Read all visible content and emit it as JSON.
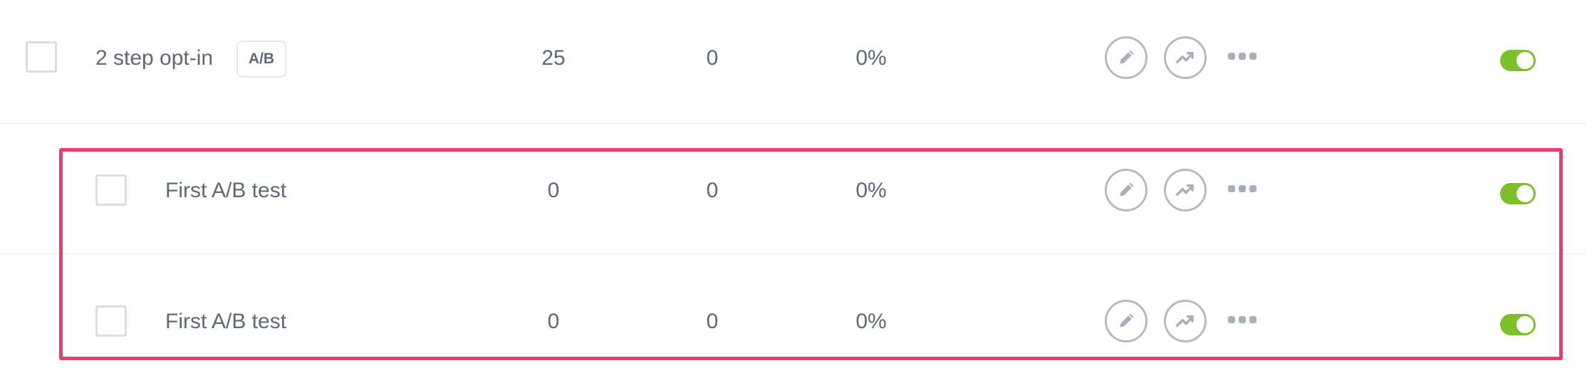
{
  "rows": [
    {
      "name": "2 step opt-in",
      "badge": "A/B",
      "col1": "25",
      "col2": "0",
      "col3": "0%",
      "icons": [
        "pencil-icon",
        "trend-icon",
        "more-icon"
      ],
      "enabled": true
    },
    {
      "name": "First A/B test",
      "col1": "0",
      "col2": "0",
      "col3": "0%",
      "icons": [
        "pencil-icon",
        "trend-icon",
        "more-icon"
      ],
      "enabled": true
    },
    {
      "name": "First A/B test",
      "col1": "0",
      "col2": "0",
      "col3": "0%",
      "icons": [
        "pencil-icon",
        "trend-icon",
        "more-icon"
      ],
      "enabled": true
    }
  ],
  "colors": {
    "text": "#5f6876",
    "icon": "#a9aebb",
    "toggle_on": "#7cc02b",
    "highlight": "#ef3b6e",
    "checkbox_border": "#dcdde0"
  }
}
